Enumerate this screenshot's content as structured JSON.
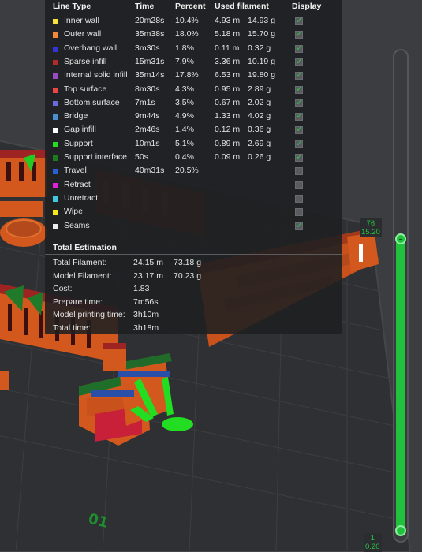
{
  "panel": {
    "headers": {
      "line_type": "Line Type",
      "time": "Time",
      "percent": "Percent",
      "used_filament": "Used filament",
      "display": "Display"
    },
    "rows": [
      {
        "label": "Inner wall",
        "color": "#f5e33a",
        "time": "20m28s",
        "percent": "10.4%",
        "length": "4.93 m",
        "weight": "14.93 g",
        "display": true
      },
      {
        "label": "Outer wall",
        "color": "#f08a3a",
        "time": "35m38s",
        "percent": "18.0%",
        "length": "5.18 m",
        "weight": "15.70 g",
        "display": true
      },
      {
        "label": "Overhang wall",
        "color": "#3333d8",
        "time": "3m30s",
        "percent": "1.8%",
        "length": "0.11 m",
        "weight": "0.32 g",
        "display": true
      },
      {
        "label": "Sparse infill",
        "color": "#b32a2a",
        "time": "15m31s",
        "percent": "7.9%",
        "length": "3.36 m",
        "weight": "10.19 g",
        "display": true
      },
      {
        "label": "Internal solid infill",
        "color": "#9b4bc8",
        "time": "35m14s",
        "percent": "17.8%",
        "length": "6.53 m",
        "weight": "19.80 g",
        "display": true
      },
      {
        "label": "Top surface",
        "color": "#f04545",
        "time": "8m30s",
        "percent": "4.3%",
        "length": "0.95 m",
        "weight": "2.89 g",
        "display": true
      },
      {
        "label": "Bottom surface",
        "color": "#6b6be0",
        "time": "7m1s",
        "percent": "3.5%",
        "length": "0.67 m",
        "weight": "2.02 g",
        "display": true
      },
      {
        "label": "Bridge",
        "color": "#4a8fd1",
        "time": "9m44s",
        "percent": "4.9%",
        "length": "1.33 m",
        "weight": "4.02 g",
        "display": true
      },
      {
        "label": "Gap infill",
        "color": "#ffffff",
        "time": "2m46s",
        "percent": "1.4%",
        "length": "0.12 m",
        "weight": "0.36 g",
        "display": true
      },
      {
        "label": "Support",
        "color": "#22dd22",
        "time": "10m1s",
        "percent": "5.1%",
        "length": "0.89 m",
        "weight": "2.69 g",
        "display": true
      },
      {
        "label": "Support interface",
        "color": "#1e7a1e",
        "time": "50s",
        "percent": "0.4%",
        "length": "0.09 m",
        "weight": "0.26 g",
        "display": true
      },
      {
        "label": "Travel",
        "color": "#2a5fd6",
        "time": "40m31s",
        "percent": "20.5%",
        "length": "",
        "weight": "",
        "display": false
      },
      {
        "label": "Retract",
        "color": "#e020e0",
        "time": "",
        "percent": "",
        "length": "",
        "weight": "",
        "display": false
      },
      {
        "label": "Unretract",
        "color": "#40c8e0",
        "time": "",
        "percent": "",
        "length": "",
        "weight": "",
        "display": false
      },
      {
        "label": "Wipe",
        "color": "#f5e620",
        "time": "",
        "percent": "",
        "length": "",
        "weight": "",
        "display": false
      },
      {
        "label": "Seams",
        "color": "#eeeeee",
        "time": "",
        "percent": "",
        "length": "",
        "weight": "",
        "display": true
      }
    ],
    "estimation": {
      "title": "Total Estimation",
      "rows": [
        {
          "label": "Total Filament:",
          "value": "24.15 m",
          "extra": "73.18 g"
        },
        {
          "label": "Model Filament:",
          "value": "23.17 m",
          "extra": "70.23 g"
        },
        {
          "label": "Cost:",
          "value": "1.83",
          "extra": ""
        },
        {
          "label": "Prepare time:",
          "value": "7m56s",
          "extra": ""
        },
        {
          "label": "Model printing time:",
          "value": "3h10m",
          "extra": ""
        },
        {
          "label": "Total time:",
          "value": "3h18m",
          "extra": ""
        }
      ]
    }
  },
  "slider": {
    "top_layer": "76",
    "top_height": "15.20",
    "bottom_layer": "1",
    "bottom_height": "0.20",
    "accent_color": "#21c13d"
  },
  "plate": {
    "label": "01"
  }
}
